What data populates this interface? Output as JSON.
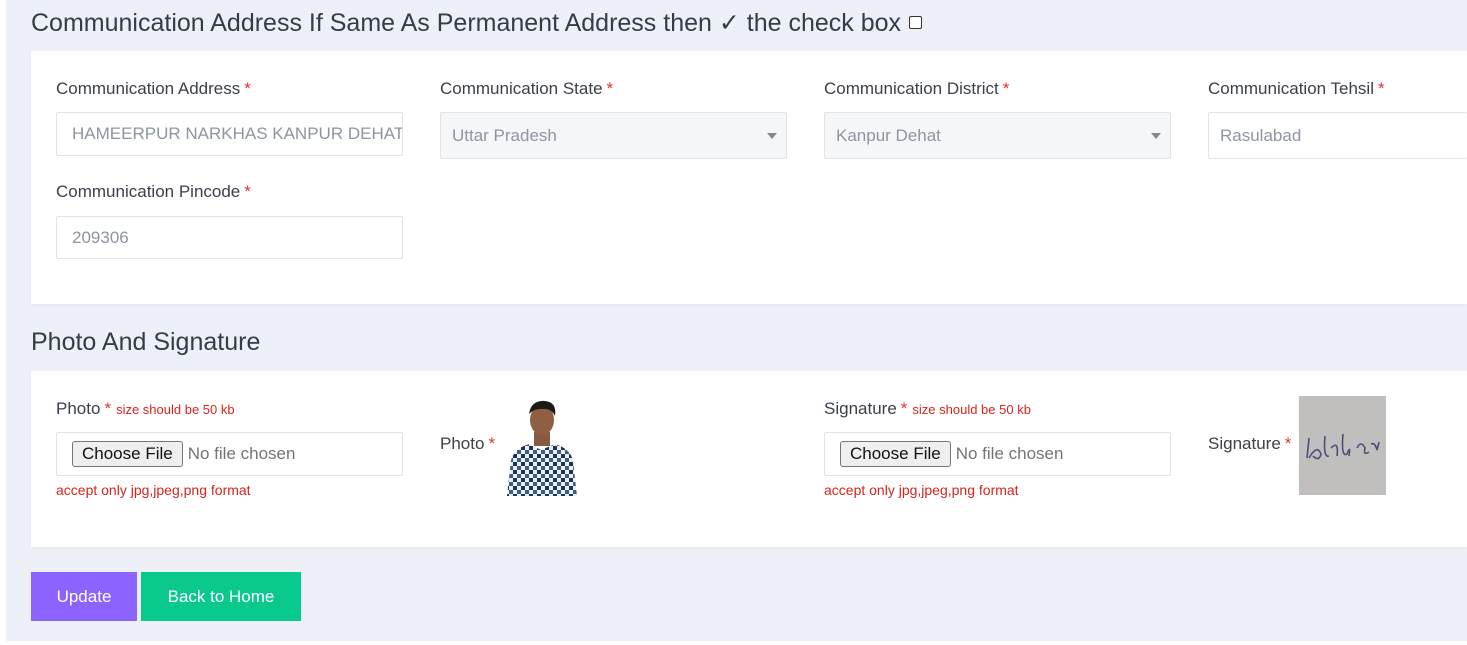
{
  "communication": {
    "title": "Communication Address If Same As Permanent Address then ✓ the check box",
    "fields": {
      "address": {
        "label": "Communication Address",
        "value": "HAMEERPUR NARKHAS KANPUR DEHAT"
      },
      "state": {
        "label": "Communication State",
        "value": "Uttar Pradesh"
      },
      "district": {
        "label": "Communication District",
        "value": "Kanpur Dehat"
      },
      "tehsil": {
        "label": "Communication Tehsil",
        "value": "Rasulabad"
      },
      "pincode": {
        "label": "Communication Pincode",
        "value": "209306"
      }
    },
    "required_mark": "*"
  },
  "photo_signature": {
    "title": "Photo And Signature",
    "photo": {
      "label": "Photo",
      "size_hint": "size should be 50 kb",
      "choose_label": "Choose File",
      "no_file": "No file chosen",
      "accept_note": "accept only jpg,jpeg,png format",
      "preview_label": "Photo"
    },
    "signature": {
      "label": "Signature",
      "size_hint": "size should be 50 kb",
      "choose_label": "Choose File",
      "no_file": "No file chosen",
      "accept_note": "accept only jpg,jpeg,png format",
      "preview_label": "Signature"
    }
  },
  "actions": {
    "update": "Update",
    "back_home": "Back to Home"
  },
  "colors": {
    "page_bg": "#eef0f8",
    "required": "#e0352b",
    "update_button": "#8c63ff",
    "home_button": "#0ac98c"
  }
}
